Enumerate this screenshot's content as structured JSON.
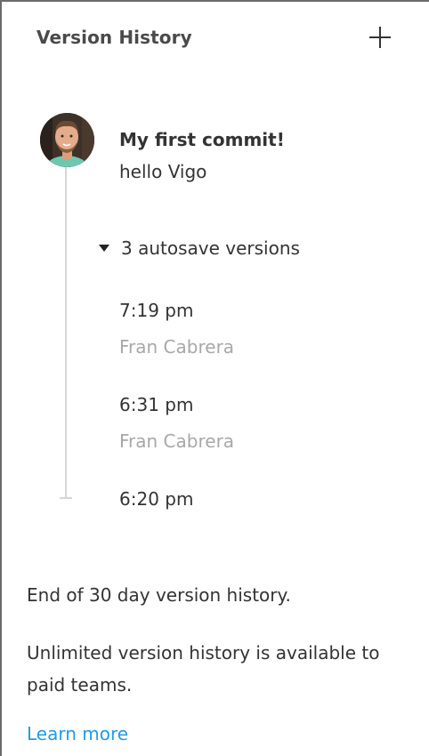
{
  "header": {
    "title": "Version History",
    "add_icon": "plus-icon"
  },
  "commit": {
    "title": "My first commit!",
    "description": "hello Vigo"
  },
  "autosave": {
    "label": "3 autosave versions",
    "expanded": true,
    "versions": [
      {
        "time": "7:19 pm",
        "author": "Fran Cabrera"
      },
      {
        "time": "6:31 pm",
        "author": "Fran Cabrera"
      },
      {
        "time": "6:20 pm",
        "author": ""
      }
    ]
  },
  "footer": {
    "end_text": "End of 30 day version history.",
    "note": "Unlimited version history is available to paid teams.",
    "link_label": "Learn more"
  },
  "colors": {
    "text": "#333333",
    "muted": "#a8a8a8",
    "link": "#1e9ce6",
    "timeline": "#d6d6d6"
  }
}
